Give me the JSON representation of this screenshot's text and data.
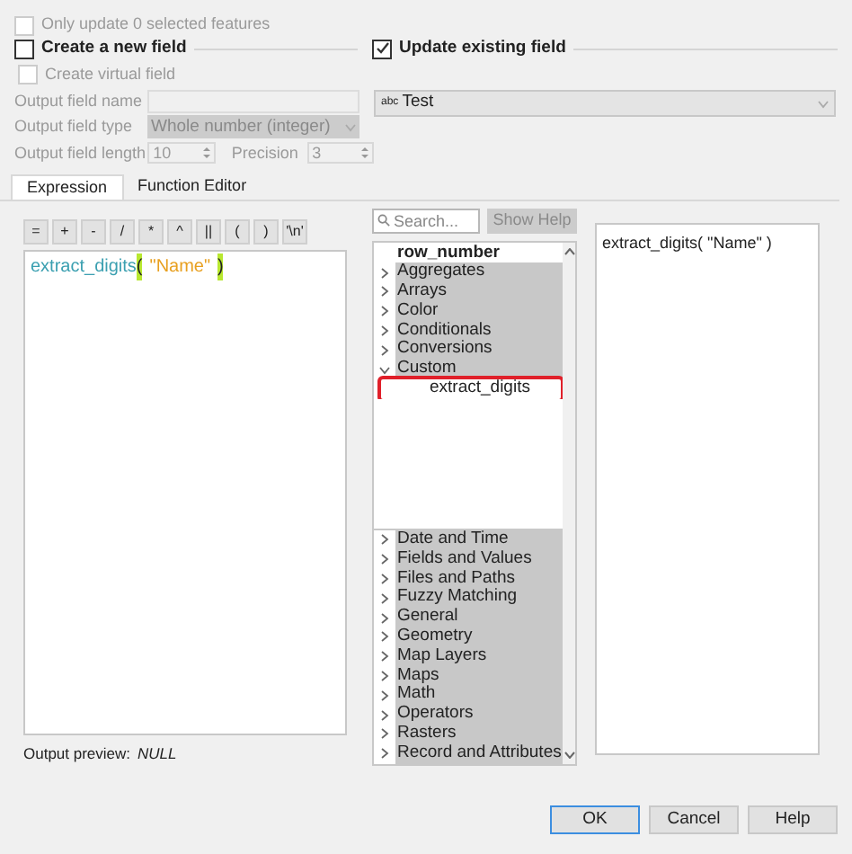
{
  "only_update": {
    "label": "Only update 0 selected features",
    "checked": false,
    "disabled": true
  },
  "create_field": {
    "label": "Create a new field",
    "checked": false
  },
  "update_field": {
    "label": "Update existing field",
    "checked": true,
    "field_type": "abc",
    "field": "Test"
  },
  "virtual_field": {
    "label": "Create virtual field",
    "checked": false,
    "disabled": true
  },
  "output_name": {
    "label": "Output field name"
  },
  "output_type": {
    "label": "Output field type",
    "value": "Whole number (integer)"
  },
  "output_length": {
    "label": "Output field length",
    "value": "10"
  },
  "precision": {
    "label": "Precision",
    "value": "3"
  },
  "tabs": [
    {
      "label": "Expression",
      "selected": true
    },
    {
      "label": "Function Editor",
      "selected": false
    }
  ],
  "operators": [
    "=",
    "+",
    "-",
    "/",
    "*",
    "^",
    "||",
    "(",
    ")",
    "'\\n'"
  ],
  "expression": {
    "function": "extract_digits",
    "open": "(",
    "argument": "\"Name\"",
    "close": ")"
  },
  "output_preview": {
    "label": "Output preview:",
    "value": "NULL"
  },
  "search": {
    "placeholder": "Search...",
    "button": "Show Help"
  },
  "tree": [
    {
      "label": "row_number",
      "kind": "function"
    },
    {
      "label": "Aggregates",
      "kind": "group",
      "expanded": false
    },
    {
      "label": "Arrays",
      "kind": "group",
      "expanded": false
    },
    {
      "label": "Color",
      "kind": "group",
      "expanded": false
    },
    {
      "label": "Conditionals",
      "kind": "group",
      "expanded": false
    },
    {
      "label": "Conversions",
      "kind": "group",
      "expanded": false
    },
    {
      "label": "Custom",
      "kind": "group",
      "expanded": true,
      "children": [
        {
          "label": "extract_digits",
          "kind": "function",
          "outlined": true
        }
      ]
    },
    {
      "label": "Date and Time",
      "kind": "group",
      "expanded": false,
      "gap_before": true
    },
    {
      "label": "Fields and Values",
      "kind": "group",
      "expanded": false
    },
    {
      "label": "Files and Paths",
      "kind": "group",
      "expanded": false
    },
    {
      "label": "Fuzzy Matching",
      "kind": "group",
      "expanded": false
    },
    {
      "label": "General",
      "kind": "group",
      "expanded": false
    },
    {
      "label": "Geometry",
      "kind": "group",
      "expanded": false
    },
    {
      "label": "Map Layers",
      "kind": "group",
      "expanded": false
    },
    {
      "label": "Maps",
      "kind": "group",
      "expanded": false
    },
    {
      "label": "Math",
      "kind": "group",
      "expanded": false
    },
    {
      "label": "Operators",
      "kind": "group",
      "expanded": false
    },
    {
      "label": "Rasters",
      "kind": "group",
      "expanded": false
    },
    {
      "label": "Record and Attributes",
      "kind": "group",
      "expanded": false
    }
  ],
  "help_text": "extract_digits( \"Name\" )",
  "buttons": [
    {
      "label": "OK",
      "default": true
    },
    {
      "label": "Cancel",
      "default": false
    },
    {
      "label": "Help",
      "default": false
    }
  ]
}
